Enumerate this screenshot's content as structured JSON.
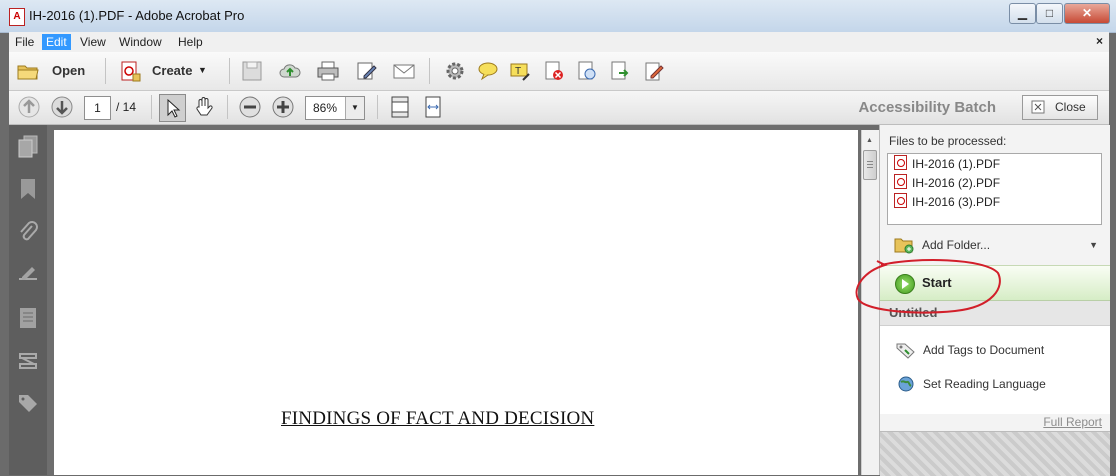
{
  "window": {
    "title": "IH-2016 (1).PDF - Adobe Acrobat Pro",
    "doc_close_glyph": "×"
  },
  "menu": {
    "items": [
      "File",
      "Edit",
      "View",
      "Window",
      "Help"
    ],
    "active": "Edit"
  },
  "toolbar": {
    "open_label": "Open",
    "create_label": "Create",
    "icons": [
      "save-icon",
      "upload-cloud-icon",
      "print-icon",
      "edit-icon",
      "email-icon",
      "settings-icon",
      "comment-icon",
      "highlight-icon",
      "redact-icon",
      "combine-icon",
      "export-icon",
      "sign-icon"
    ]
  },
  "nav": {
    "page_current": "1",
    "page_total": "/ 14",
    "zoom": "86%"
  },
  "accessibility_panel": {
    "title": "Accessibility Batch",
    "close_label": "Close",
    "files_label": "Files to be processed:",
    "files": [
      "IH-2016 (1).PDF",
      "IH-2016 (2).PDF",
      "IH-2016 (3).PDF"
    ],
    "add_folder_label": "Add Folder...",
    "start_label": "Start",
    "section_title": "Untitled",
    "actions": [
      "Add Tags to Document",
      "Set Reading Language"
    ],
    "full_report_label": "Full Report"
  },
  "document": {
    "heading": "FINDINGS OF FACT AND DECISION"
  },
  "colors": {
    "menu_active": "#3399ff",
    "start_green": "#3f9a1e",
    "annotation_red": "#d21f2a"
  }
}
